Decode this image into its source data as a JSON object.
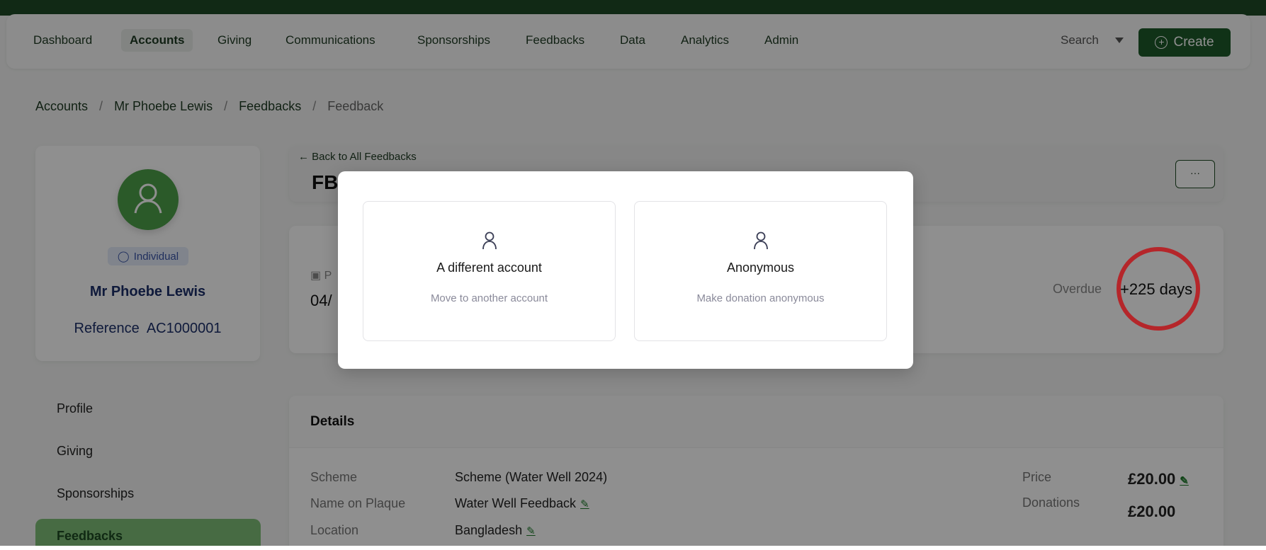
{
  "nav": {
    "items": [
      "Dashboard",
      "Accounts",
      "Giving",
      "Communications",
      "Sponsorships",
      "Feedbacks",
      "Data",
      "Analytics",
      "Admin"
    ],
    "active": "Accounts",
    "search": "Search",
    "create": "Create"
  },
  "breadcrumb": [
    "Accounts",
    "Mr Phoebe Lewis",
    "Feedbacks",
    "Feedback"
  ],
  "profile": {
    "type": "Individual",
    "name": "Mr Phoebe Lewis",
    "reference_label": "Reference",
    "reference": "AC1000001"
  },
  "sidebar": [
    "Profile",
    "Giving",
    "Sponsorships",
    "Feedbacks"
  ],
  "header": {
    "back": "← Back to All Feedbacks",
    "title": "FB",
    "more": "···"
  },
  "summary": {
    "date_label": "P",
    "date": "04/",
    "overdue_label": "Overdue",
    "overdue": "+225 days"
  },
  "details": {
    "title": "Details",
    "rows": [
      {
        "label": "Scheme",
        "value": "Scheme (Water Well 2024)"
      },
      {
        "label": "Name on Plaque",
        "value": "Water Well Feedback"
      },
      {
        "label": "Location",
        "value": "Bangladesh"
      }
    ],
    "price_label": "Price",
    "price": "£20.00",
    "donations_label": "Donations",
    "donations": "£20.00"
  },
  "modal": {
    "options": [
      {
        "title": "A different account",
        "subtitle": "Move to another account",
        "icon": "user-icon"
      },
      {
        "title": "Anonymous",
        "subtitle": "Make donation anonymous",
        "icon": "user-icon"
      }
    ]
  },
  "colors": {
    "brand": "#1d5a2a",
    "annotation": "#b5262a"
  }
}
